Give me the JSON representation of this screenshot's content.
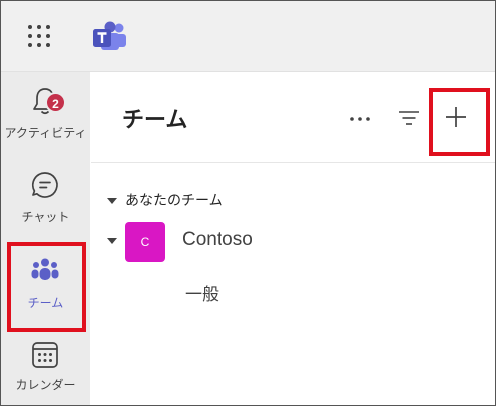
{
  "app": {
    "name": "Microsoft Teams"
  },
  "rail": {
    "items": [
      {
        "label": "アクティビティ",
        "badge": "2"
      },
      {
        "label": "チャット"
      },
      {
        "label": "チーム"
      },
      {
        "label": "カレンダー"
      }
    ]
  },
  "teams_pane": {
    "title": "チーム",
    "section_label": "あなたのチーム",
    "teams": [
      {
        "initial": "C",
        "name": "Contoso",
        "channels": [
          "一般"
        ]
      }
    ]
  },
  "icons": {
    "waffle": "app-launcher-icon",
    "more": "more-options-icon",
    "filter": "filter-icon",
    "add": "plus-icon"
  },
  "colors": {
    "accent": "#5b5fc7",
    "highlight": "#e0101e",
    "badge": "#c4314b",
    "team_avatar": "#d917c4"
  }
}
